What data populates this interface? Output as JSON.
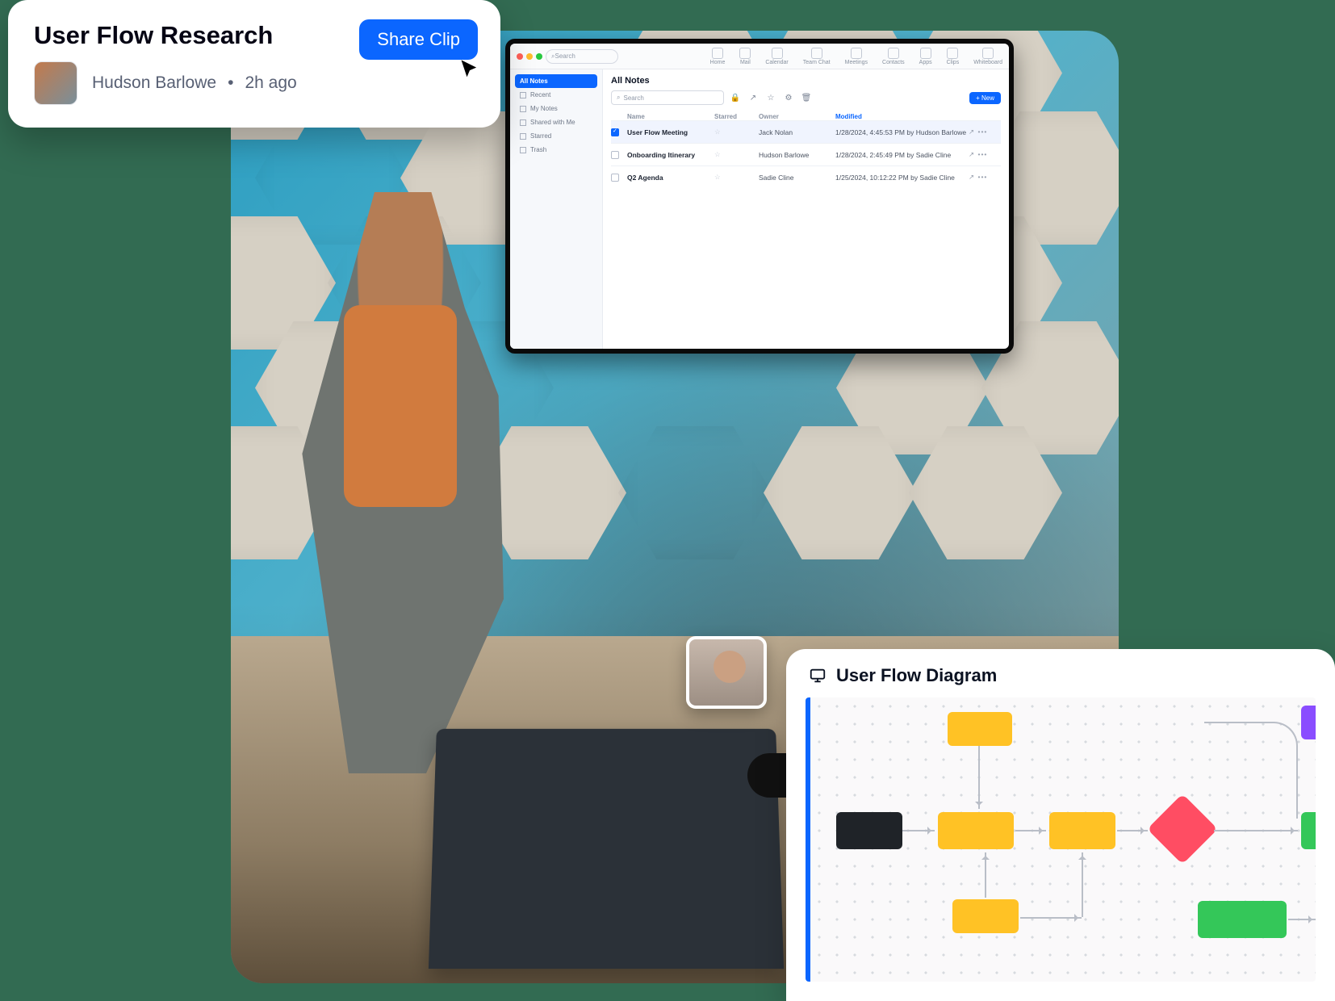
{
  "card": {
    "title": "User Flow Research",
    "author": "Hudson Barlowe",
    "timestamp": "2h ago",
    "share_label": "Share Clip"
  },
  "tv": {
    "search_placeholder": "Search",
    "tabs": [
      "Home",
      "Mail",
      "Calendar",
      "Team Chat",
      "Meetings",
      "Contacts",
      "Apps",
      "Clips",
      "Whiteboard"
    ],
    "sidebar_active": "All Notes",
    "sidebar_items": [
      "Recent",
      "My Notes",
      "Shared with Me",
      "Starred",
      "Trash"
    ],
    "all_notes_heading": "All Notes",
    "content_search_placeholder": "Search",
    "new_button": "+ New",
    "columns": {
      "name": "Name",
      "starred": "Starred",
      "owner": "Owner",
      "modified": "Modified"
    },
    "rows": [
      {
        "checked": true,
        "name": "User Flow Meeting",
        "owner": "Jack Nolan",
        "modified": "1/28/2024, 4:45:53 PM by Hudson Barlowe"
      },
      {
        "checked": false,
        "name": "Onboarding Itinerary",
        "owner": "Hudson Barlowe",
        "modified": "1/28/2024, 2:45:49 PM by Sadie Cline"
      },
      {
        "checked": false,
        "name": "Q2 Agenda",
        "owner": "Sadie Cline",
        "modified": "1/25/2024, 10:12:22 PM by Sadie Cline"
      }
    ]
  },
  "panel": {
    "title": "User Flow Diagram"
  },
  "colors": {
    "accent": "#0b66ff",
    "yellow": "#ffc225",
    "green": "#34c759",
    "purple": "#8a4dff",
    "red": "#ff4d63",
    "dark": "#1f2328"
  }
}
